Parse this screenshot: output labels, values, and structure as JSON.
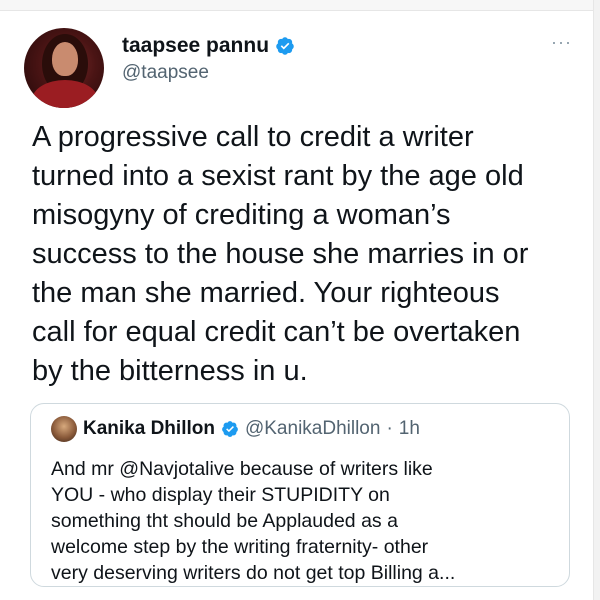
{
  "tweet": {
    "display_name": "taapsee pannu",
    "handle": "@taapsee",
    "more_label": "···",
    "text": "A progressive call to credit a writer\nturned into a sexist rant by the age old\nmisogyny of crediting a woman’s\nsuccess to the house she marries in or\nthe man she married. Your righteous\ncall for equal credit can’t be overtaken\nby the bitterness in u.",
    "verified": true
  },
  "quoted_tweet": {
    "display_name": "Kanika Dhillon",
    "handle": "@KanikaDhillon",
    "separator": "·",
    "time": "1h",
    "verified": true,
    "text": "And mr @Navjotalive because of writers like\nYOU - who display their STUPIDITY on\nsomething tht should be Applauded as a\nwelcome step by the writing fraternity- other\nvery deserving writers do not get top Billing a..."
  },
  "colors": {
    "verified_blue": "#1d9bf0",
    "secondary_text": "#536471",
    "border": "#cfd9de"
  }
}
